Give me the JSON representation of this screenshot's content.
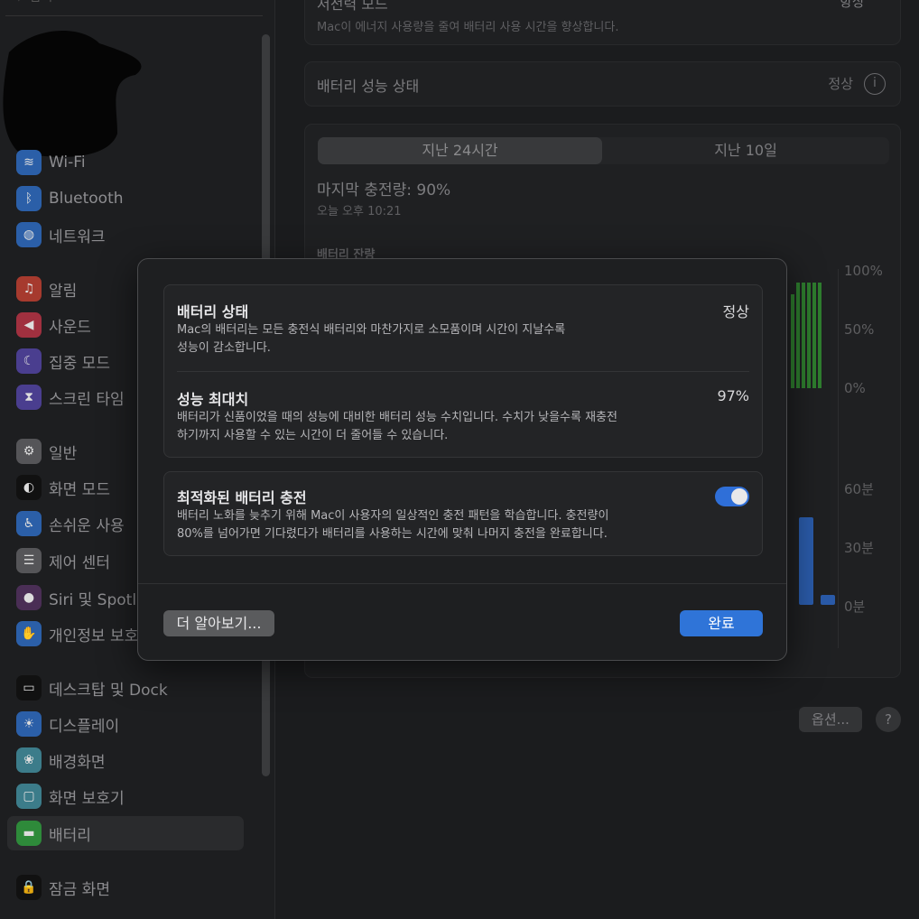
{
  "sidebar": {
    "search_placeholder": "검색",
    "items": [
      {
        "label": "Wi-Fi",
        "icon": "wifi-icon",
        "color": "#2b5fa8"
      },
      {
        "label": "Bluetooth",
        "icon": "bluetooth-icon",
        "color": "#2b5fa8"
      },
      {
        "label": "네트워크",
        "icon": "globe-icon",
        "color": "#2b5fa8"
      },
      {
        "label": "알림",
        "icon": "bell-icon",
        "color": "#a63a2e"
      },
      {
        "label": "사운드",
        "icon": "speaker-icon",
        "color": "#a0303f"
      },
      {
        "label": "집중 모드",
        "icon": "moon-icon",
        "color": "#4a3e8f"
      },
      {
        "label": "스크린 타임",
        "icon": "hourglass-icon",
        "color": "#4a3e8f"
      },
      {
        "label": "일반",
        "icon": "gear-icon",
        "color": "#555558"
      },
      {
        "label": "화면 모드",
        "icon": "appearance-icon",
        "color": "#111111"
      },
      {
        "label": "손쉬운 사용",
        "icon": "accessibility-icon",
        "color": "#2b5fa8"
      },
      {
        "label": "제어 센터",
        "icon": "control-center-icon",
        "color": "#555558"
      },
      {
        "label": "Siri 및 Spotlight",
        "icon": "siri-icon",
        "color": "#4a2e55"
      },
      {
        "label": "개인정보 보호 및 보안",
        "icon": "hand-icon",
        "color": "#2b5fa8"
      },
      {
        "label": "데스크탑 및 Dock",
        "icon": "dock-icon",
        "color": "#111111"
      },
      {
        "label": "디스플레이",
        "icon": "sun-icon",
        "color": "#2b5fa8"
      },
      {
        "label": "배경화면",
        "icon": "wallpaper-icon",
        "color": "#3c7c8a"
      },
      {
        "label": "화면 보호기",
        "icon": "screensaver-icon",
        "color": "#3c7c8a"
      },
      {
        "label": "배터리",
        "icon": "battery-icon",
        "color": "#2e8a3a",
        "selected": true
      },
      {
        "label": "잠금 화면",
        "icon": "lock-icon",
        "color": "#111111"
      }
    ]
  },
  "main": {
    "low_power": {
      "title": "저전력 모드",
      "desc": "Mac이 에너지 사용량을 줄여 배터리 사용 시간을 향상합니다.",
      "value": "항상"
    },
    "health": {
      "title": "배터리 성능 상태",
      "value": "정상"
    },
    "tabs": [
      "지난 24시간",
      "지난 10일"
    ],
    "last_charge": "마지막 충전량: 90%",
    "last_charge_time": "오늘 오후 10:21",
    "level_title": "배터리 잔량",
    "level_axis": [
      "100%",
      "50%",
      "0%"
    ],
    "usage_axis": [
      "60분",
      "30분",
      "0분"
    ],
    "battery_levels_percent": [
      80,
      90,
      90,
      90,
      90,
      90
    ],
    "usage_minutes": [
      45,
      5
    ],
    "options_label": "옵션...",
    "help_label": "?"
  },
  "dialog": {
    "battery_state": {
      "title": "배터리 상태",
      "value": "정상",
      "desc1": "Mac의 배터리는 모든 충전식 배터리와 마찬가지로 소모품이며 시간이 지날수록",
      "desc2": "성능이 감소합니다."
    },
    "max_capacity": {
      "title": "성능 최대치",
      "value": "97%",
      "desc1": "배터리가 신품이었을 때의 성능에 대비한 배터리 성능 수치입니다. 수치가 낮을수록 재충전",
      "desc2": "하기까지 사용할 수 있는 시간이 더 줄어들 수 있습니다."
    },
    "optimized": {
      "title": "최적화된 배터리 충전",
      "enabled": true,
      "desc1": "배터리 노화를 늦추기 위해 Mac이 사용자의 일상적인 충전 패턴을 학습합니다. 충전량이",
      "desc2": "80%를 넘어가면 기다렸다가 배터리를 사용하는 시간에 맞춰 나머지 충전을 완료합니다."
    },
    "learn_more": "더 알아보기...",
    "done": "완료",
    "accent": "#2f74d8"
  }
}
